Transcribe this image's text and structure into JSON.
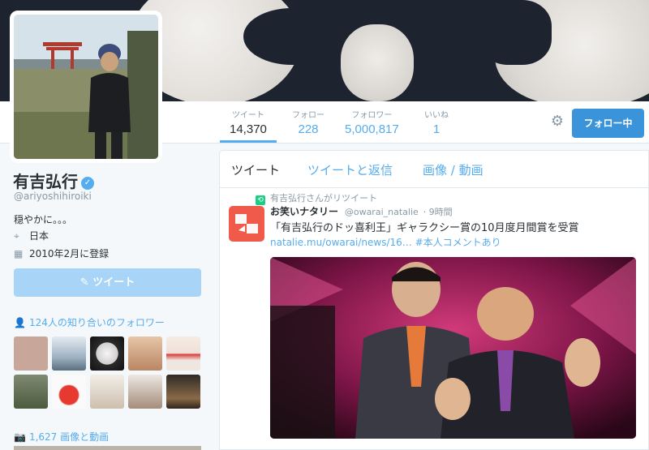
{
  "profile": {
    "name": "有吉弘行",
    "handle": "@ariyoshihiroiki",
    "bio": "穏やかに。。。",
    "location": "日本",
    "joined": "2010年2月に登録",
    "tweet_button": "ツイート",
    "followers_you_know": "124人の知り合いのフォロワー",
    "media_count": "1,627 画像と動画"
  },
  "stats": {
    "tweets_label": "ツイート",
    "tweets_value": "14,370",
    "following_label": "フォロー",
    "following_value": "228",
    "followers_label": "フォロワー",
    "followers_value": "5,000,817",
    "likes_label": "いいね",
    "likes_value": "1"
  },
  "follow_button": "フォロー中",
  "tabs": [
    "ツイート",
    "ツイートと返信",
    "画像 / 動画"
  ],
  "tweet": {
    "retweeted_by": "有吉弘行さんがリツイート",
    "author": "お笑いナタリー",
    "author_handle": "@owarai_natalie",
    "time": "· 9時間",
    "text": "「有吉弘行のドッ喜利王」ギャラクシー賞の10月度月間賞を受賞",
    "link": "natalie.mu/owarai/news/16…",
    "hashtag": "#本人コメントあり"
  },
  "colors": {
    "accent": "#55acee",
    "follow_bg": "#3b94d9",
    "retweet": "#19cf86",
    "natalie": "#f05a4b"
  },
  "icons": [
    "settings-gear-icon",
    "verified-badge-icon",
    "location-pin-icon",
    "calendar-icon",
    "compose-icon",
    "person-icon",
    "camera-icon",
    "retweet-icon"
  ]
}
